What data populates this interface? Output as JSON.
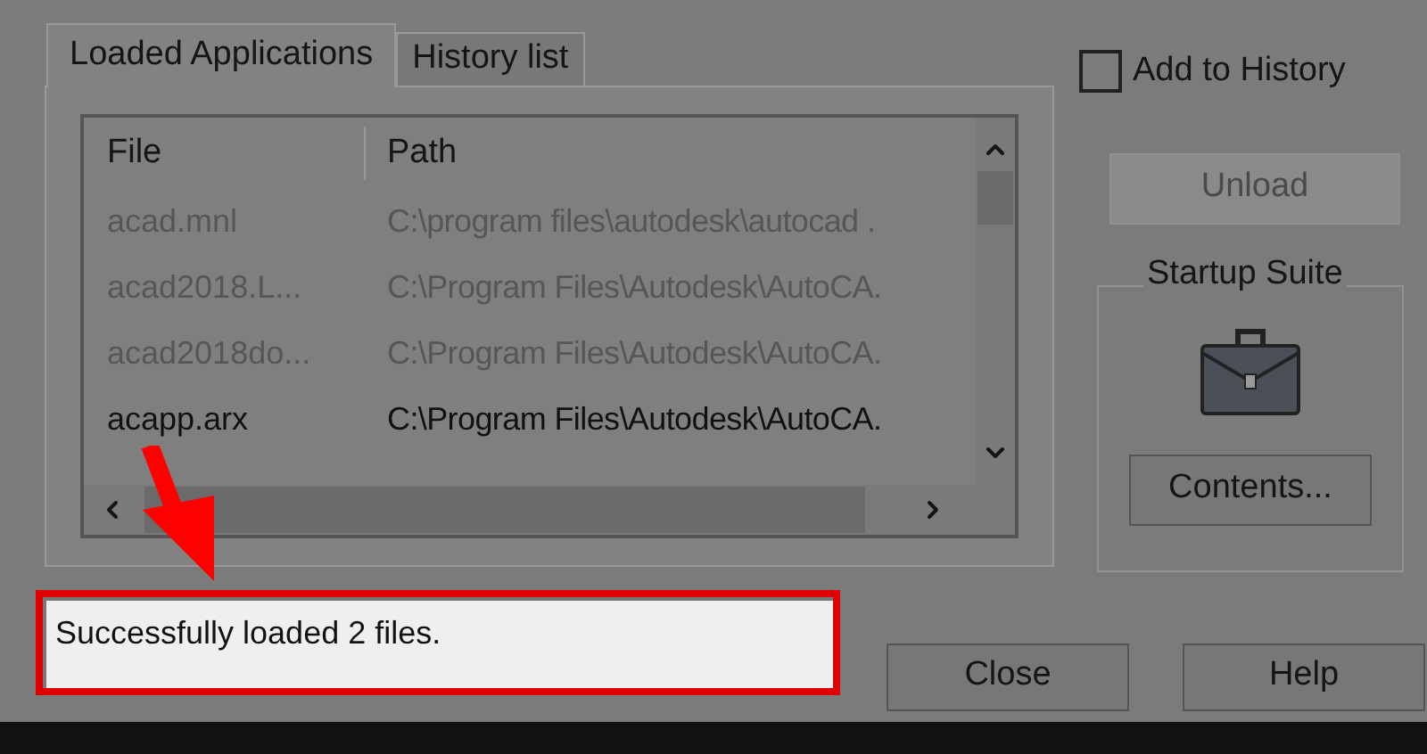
{
  "tabs": [
    {
      "label": "Loaded Applications",
      "selected": true
    },
    {
      "label": "History list",
      "selected": false
    }
  ],
  "table": {
    "columns": [
      "File",
      "Path"
    ],
    "rows": [
      {
        "file": "acad.mnl",
        "path": "C:\\program files\\autodesk\\autocad .",
        "dimmed": true
      },
      {
        "file": "acad2018.L...",
        "path": "C:\\Program Files\\Autodesk\\AutoCA.",
        "dimmed": true
      },
      {
        "file": "acad2018do...",
        "path": "C:\\Program Files\\Autodesk\\AutoCA.",
        "dimmed": true
      },
      {
        "file": "acapp.arx",
        "path": "C:\\Program Files\\Autodesk\\AutoCA.",
        "dimmed": false
      }
    ]
  },
  "add_to_history": {
    "label": "Add to History",
    "checked": false
  },
  "unload_button": {
    "label": "Unload",
    "disabled": true
  },
  "startup_suite": {
    "title": "Startup Suite",
    "button": "Contents..."
  },
  "status": {
    "value": "Successfully loaded 2 files.",
    "highlighted": true
  },
  "buttons": [
    "Close",
    "Help"
  ]
}
